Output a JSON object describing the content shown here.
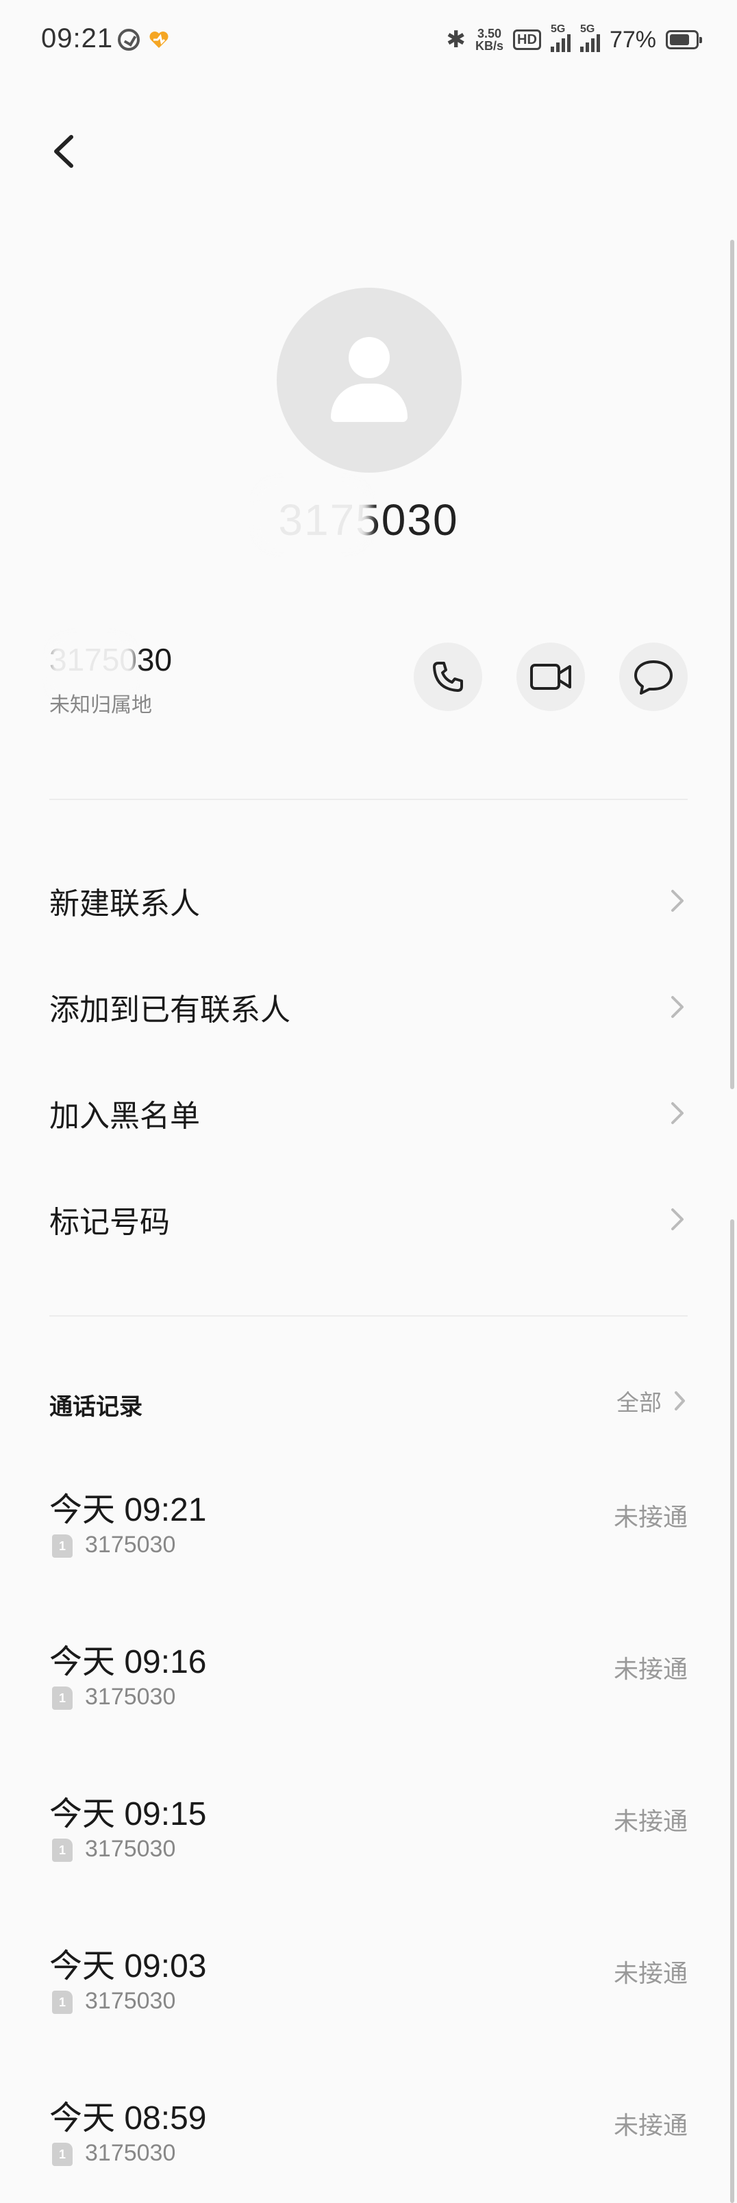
{
  "status_bar": {
    "time": "09:21",
    "net_speed_value": "3.50",
    "net_speed_unit": "KB/s",
    "hd_label": "HD",
    "sim1_label": "5G",
    "sim2_label": "5G",
    "battery_percent": "77%",
    "battery_level": 0.77
  },
  "header": {
    "title_number": "3175030"
  },
  "number_row": {
    "number": "3175030",
    "location": "未知归属地"
  },
  "menu": [
    {
      "label": "新建联系人"
    },
    {
      "label": "添加到已有联系人"
    },
    {
      "label": "加入黑名单"
    },
    {
      "label": "标记号码"
    }
  ],
  "call_log": {
    "title": "通话记录",
    "all_label": "全部",
    "entries": [
      {
        "time": "今天 09:21",
        "sim": "1",
        "number": "3175030",
        "status": "未接通"
      },
      {
        "time": "今天 09:16",
        "sim": "1",
        "number": "3175030",
        "status": "未接通"
      },
      {
        "time": "今天 09:15",
        "sim": "1",
        "number": "3175030",
        "status": "未接通"
      },
      {
        "time": "今天 09:03",
        "sim": "1",
        "number": "3175030",
        "status": "未接通"
      },
      {
        "time": "今天 08:59",
        "sim": "1",
        "number": "3175030",
        "status": "未接通"
      }
    ]
  }
}
